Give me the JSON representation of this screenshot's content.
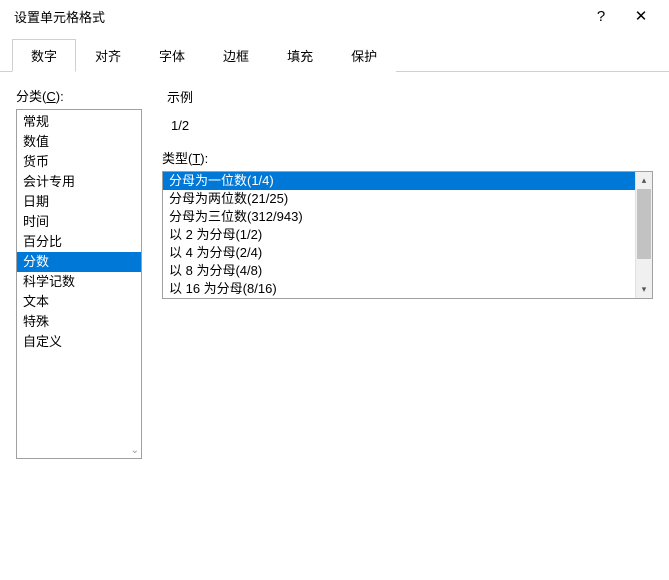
{
  "dialog": {
    "title": "设置单元格格式",
    "help_tooltip": "?",
    "close_tooltip": "✕"
  },
  "tabs": {
    "items": [
      {
        "label": "数字",
        "active": true
      },
      {
        "label": "对齐",
        "active": false
      },
      {
        "label": "字体",
        "active": false
      },
      {
        "label": "边框",
        "active": false
      },
      {
        "label": "填充",
        "active": false
      },
      {
        "label": "保护",
        "active": false
      }
    ]
  },
  "category": {
    "label_prefix": "分类(",
    "label_hotkey": "C",
    "label_suffix": "):",
    "items": [
      {
        "label": "常规",
        "selected": false
      },
      {
        "label": "数值",
        "selected": false
      },
      {
        "label": "货币",
        "selected": false
      },
      {
        "label": "会计专用",
        "selected": false
      },
      {
        "label": "日期",
        "selected": false
      },
      {
        "label": "时间",
        "selected": false
      },
      {
        "label": "百分比",
        "selected": false
      },
      {
        "label": "分数",
        "selected": true
      },
      {
        "label": "科学记数",
        "selected": false
      },
      {
        "label": "文本",
        "selected": false
      },
      {
        "label": "特殊",
        "selected": false
      },
      {
        "label": "自定义",
        "selected": false
      }
    ]
  },
  "sample": {
    "label": "示例",
    "value": "1/2"
  },
  "type": {
    "label_prefix": "类型(",
    "label_hotkey": "T",
    "label_suffix": "):",
    "items": [
      {
        "label": "分母为一位数(1/4)",
        "selected": true
      },
      {
        "label": "分母为两位数(21/25)",
        "selected": false
      },
      {
        "label": "分母为三位数(312/943)",
        "selected": false
      },
      {
        "label": "以 2 为分母(1/2)",
        "selected": false
      },
      {
        "label": "以 4 为分母(2/4)",
        "selected": false
      },
      {
        "label": "以 8 为分母(4/8)",
        "selected": false
      },
      {
        "label": "以 16 为分母(8/16)",
        "selected": false
      }
    ]
  }
}
